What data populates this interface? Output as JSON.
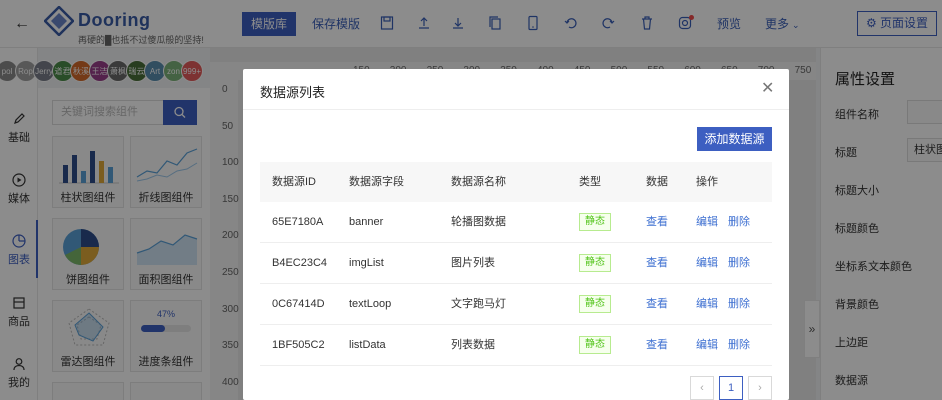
{
  "header": {
    "brand": "Dooring",
    "slogan": "再硬的█也抵不过傻瓜般的坚持!",
    "template_lib": "模版库",
    "save_template": "保存模版",
    "preview": "预览",
    "more": "更多",
    "page_settings": "页面设置",
    "accent": "#3d5fc1"
  },
  "avatars": [
    {
      "text": "pol",
      "color": "#8a8a8a"
    },
    {
      "text": "Rop",
      "color": "#a0a0a0"
    },
    {
      "text": "Jerry",
      "color": "#7a7f8a"
    },
    {
      "text": "道君",
      "color": "#4c8c4a"
    },
    {
      "text": "秋溪",
      "color": "#d46a2b"
    },
    {
      "text": "王洁",
      "color": "#9a3f8a"
    },
    {
      "text": "萧枫",
      "color": "#6b6b6b"
    },
    {
      "text": "瑞云",
      "color": "#4a6f3a"
    },
    {
      "text": "Art",
      "color": "#5a8fb0"
    },
    {
      "text": "zon",
      "color": "#7db37a"
    },
    {
      "text": "999+",
      "color": "#e45c5c"
    }
  ],
  "leftnav": [
    {
      "label": "基础",
      "icon": "pen-icon"
    },
    {
      "label": "媒体",
      "icon": "play-icon"
    },
    {
      "label": "图表",
      "icon": "pie-chart-icon"
    },
    {
      "label": "商品",
      "icon": "store-icon"
    },
    {
      "label": "我的",
      "icon": "user-icon"
    }
  ],
  "components": {
    "search_placeholder": "关键词搜索组件",
    "cards": [
      {
        "label": "柱状图组件"
      },
      {
        "label": "折线图组件"
      },
      {
        "label": "饼图组件"
      },
      {
        "label": "面积图组件"
      },
      {
        "label": "雷达图组件"
      },
      {
        "label": "进度条组件",
        "progress_text": "47%",
        "progress": 0.47
      }
    ]
  },
  "ruler": {
    "top": [
      "150",
      "200",
      "250",
      "300",
      "350",
      "400",
      "450",
      "500",
      "550",
      "600",
      "650",
      "700",
      "750"
    ],
    "left": [
      "0",
      "50",
      "100",
      "150",
      "200",
      "250",
      "300",
      "350",
      "400"
    ]
  },
  "right_panel": {
    "title": "属性设置",
    "labels": [
      "组件名称",
      "标题",
      "标题大小",
      "标题颜色",
      "坐标系文本颜色",
      "背景颜色",
      "上边距",
      "数据源"
    ],
    "title_value": "柱状图"
  },
  "modal": {
    "title": "数据源列表",
    "add_button": "添加数据源",
    "columns": [
      "数据源ID",
      "数据源字段",
      "数据源名称",
      "类型",
      "数据",
      "操作"
    ],
    "rows": [
      {
        "id": "65E7180A",
        "field": "banner",
        "name": "轮播图数据",
        "type": "静态",
        "data": "查看",
        "edit": "编辑",
        "delete": "删除"
      },
      {
        "id": "B4EC23C4",
        "field": "imgList",
        "name": "图片列表",
        "type": "静态",
        "data": "查看",
        "edit": "编辑",
        "delete": "删除"
      },
      {
        "id": "0C67414D",
        "field": "textLoop",
        "name": "文字跑马灯",
        "type": "静态",
        "data": "查看",
        "edit": "编辑",
        "delete": "删除"
      },
      {
        "id": "1BF505C2",
        "field": "listData",
        "name": "列表数据",
        "type": "静态",
        "data": "查看",
        "edit": "编辑",
        "delete": "删除"
      }
    ],
    "pagination": {
      "prev": "‹",
      "current": "1",
      "next": "›"
    }
  }
}
